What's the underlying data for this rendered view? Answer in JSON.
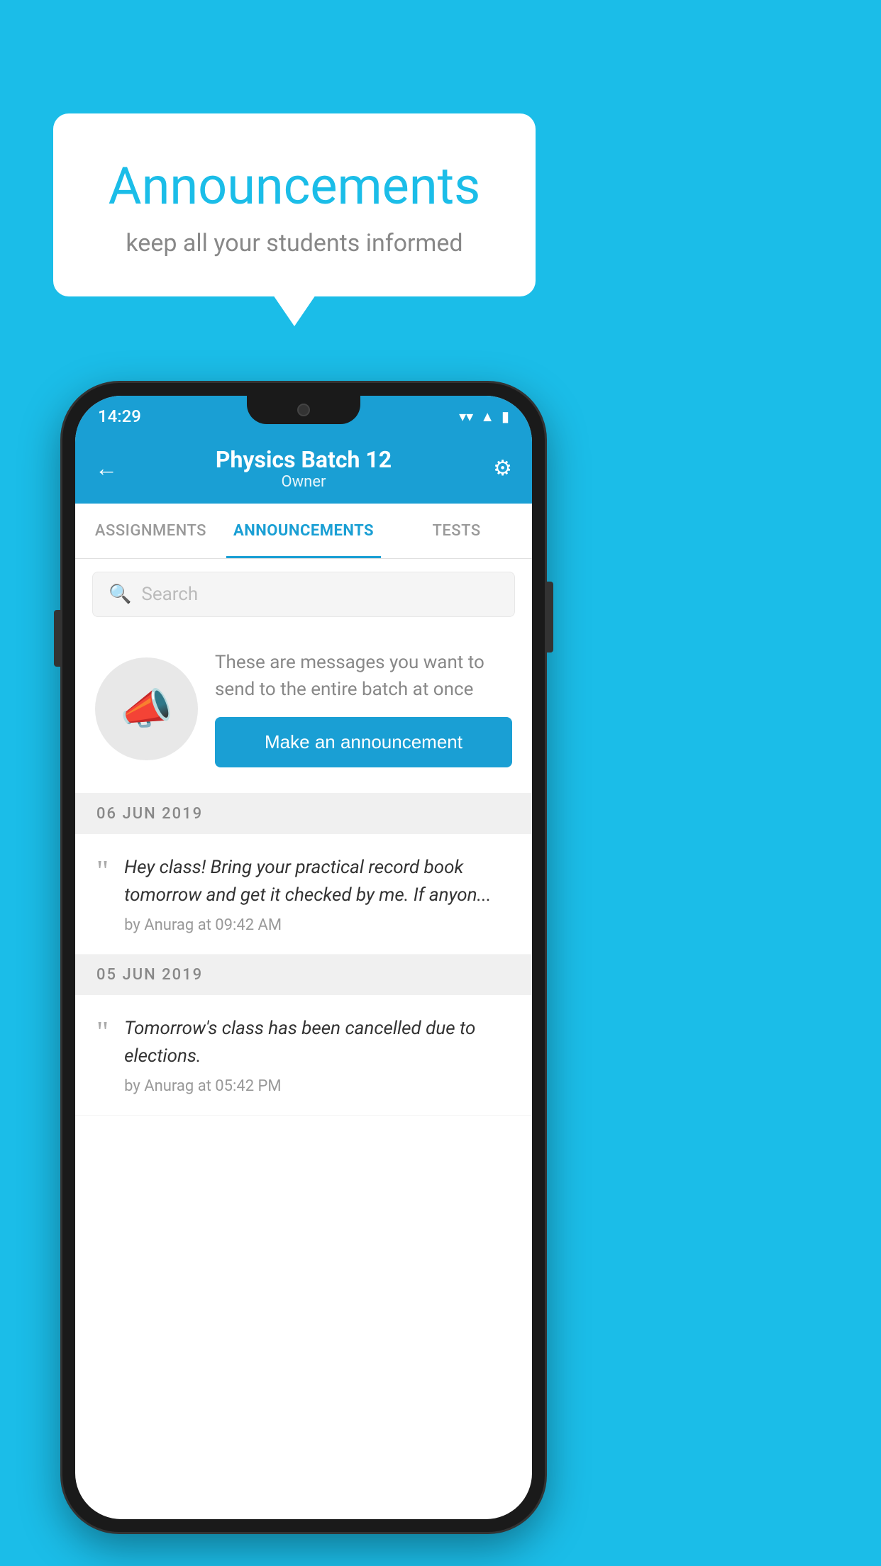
{
  "background_color": "#1bbde8",
  "bubble": {
    "title": "Announcements",
    "subtitle": "keep all your students informed"
  },
  "phone": {
    "status_bar": {
      "time": "14:29",
      "icons": [
        "wifi",
        "signal",
        "battery"
      ]
    },
    "app_bar": {
      "title": "Physics Batch 12",
      "subtitle": "Owner",
      "back_label": "←",
      "settings_label": "⚙"
    },
    "tabs": [
      {
        "label": "ASSIGNMENTS",
        "active": false
      },
      {
        "label": "ANNOUNCEMENTS",
        "active": true
      },
      {
        "label": "TESTS",
        "active": false
      }
    ],
    "search": {
      "placeholder": "Search"
    },
    "announcement_prompt": {
      "description": "These are messages you want to send to the entire batch at once",
      "button_label": "Make an announcement"
    },
    "announcements": [
      {
        "date": "06  JUN  2019",
        "text": "Hey class! Bring your practical record book tomorrow and get it checked by me. If anyon...",
        "author": "by Anurag at 09:42 AM"
      },
      {
        "date": "05  JUN  2019",
        "text": "Tomorrow's class has been cancelled due to elections.",
        "author": "by Anurag at 05:42 PM"
      }
    ]
  }
}
